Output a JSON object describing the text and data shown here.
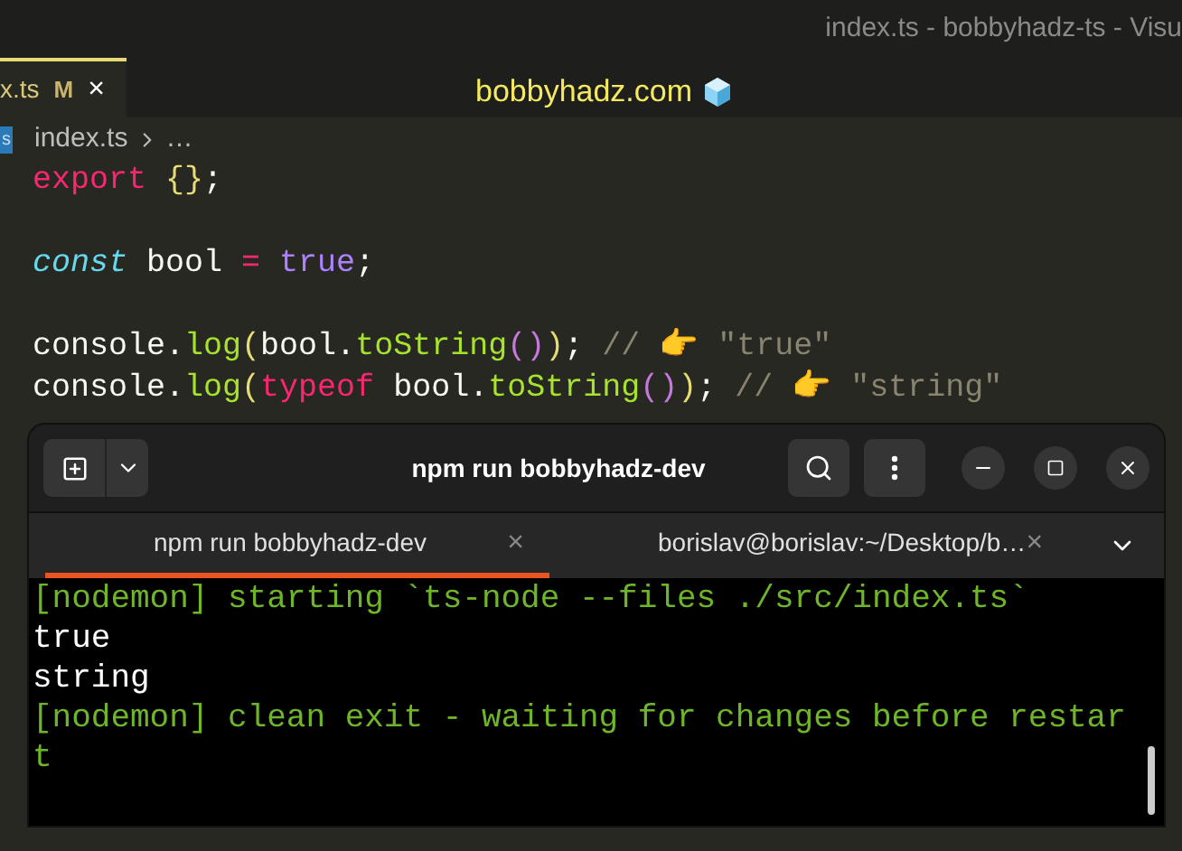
{
  "window": {
    "title": "index.ts - bobbyhadz-ts - Visu"
  },
  "editor_tab": {
    "label": "x.ts",
    "badge": "M",
    "close": "×",
    "selected": true
  },
  "banner": "bobbyhadz.com",
  "breadcrumb": {
    "file_badge": "s",
    "file": "index.ts",
    "more": "…"
  },
  "code_lines": [
    {
      "kind": "code",
      "tokens": [
        {
          "kind": "keyword",
          "text": "export"
        },
        {
          "kind": "brace",
          "text": " {}"
        },
        {
          "kind": "plain",
          "text": ";"
        }
      ]
    },
    {
      "kind": "blank"
    },
    {
      "kind": "code",
      "tokens": [
        {
          "kind": "storage",
          "text": "const"
        },
        {
          "kind": "plain",
          "text": " bool "
        },
        {
          "kind": "keyword",
          "text": "="
        },
        {
          "kind": "constant",
          "text": " true"
        },
        {
          "kind": "plain",
          "text": ";"
        }
      ]
    },
    {
      "kind": "blank"
    },
    {
      "kind": "code",
      "tokens": [
        {
          "kind": "plain",
          "text": "console."
        },
        {
          "kind": "func",
          "text": "log"
        },
        {
          "kind": "brace",
          "text": "("
        },
        {
          "kind": "plain",
          "text": "bool."
        },
        {
          "kind": "func",
          "text": "toString"
        },
        {
          "kind": "paren",
          "text": "()"
        },
        {
          "kind": "brace",
          "text": ")"
        },
        {
          "kind": "plain",
          "text": "; "
        },
        {
          "kind": "comment",
          "text": "// 👉 \"true\""
        }
      ]
    },
    {
      "kind": "code",
      "tokens": [
        {
          "kind": "plain",
          "text": "console."
        },
        {
          "kind": "func",
          "text": "log"
        },
        {
          "kind": "brace",
          "text": "("
        },
        {
          "kind": "keyword",
          "text": "typeof"
        },
        {
          "kind": "plain",
          "text": " bool."
        },
        {
          "kind": "func",
          "text": "toString"
        },
        {
          "kind": "paren",
          "text": "()"
        },
        {
          "kind": "brace",
          "text": ")"
        },
        {
          "kind": "plain",
          "text": "; "
        },
        {
          "kind": "comment",
          "text": "// 👉 \"string\""
        }
      ]
    }
  ],
  "terminal": {
    "title": "npm run bobbyhadz-dev",
    "tabs": [
      {
        "label": "npm run bobbyhadz-dev",
        "selected": true
      },
      {
        "label": "borislav@borislav:~/Desktop/b…",
        "selected": false
      }
    ],
    "close": "×",
    "lines": [
      {
        "kind": "log",
        "text": "[nodemon] starting `ts-node --files ./src/index.ts`"
      },
      {
        "kind": "output",
        "text": "true"
      },
      {
        "kind": "output",
        "text": "string"
      },
      {
        "kind": "log",
        "text": "[nodemon] clean exit - waiting for changes before restar"
      },
      {
        "kind": "log",
        "text": "t"
      }
    ]
  }
}
